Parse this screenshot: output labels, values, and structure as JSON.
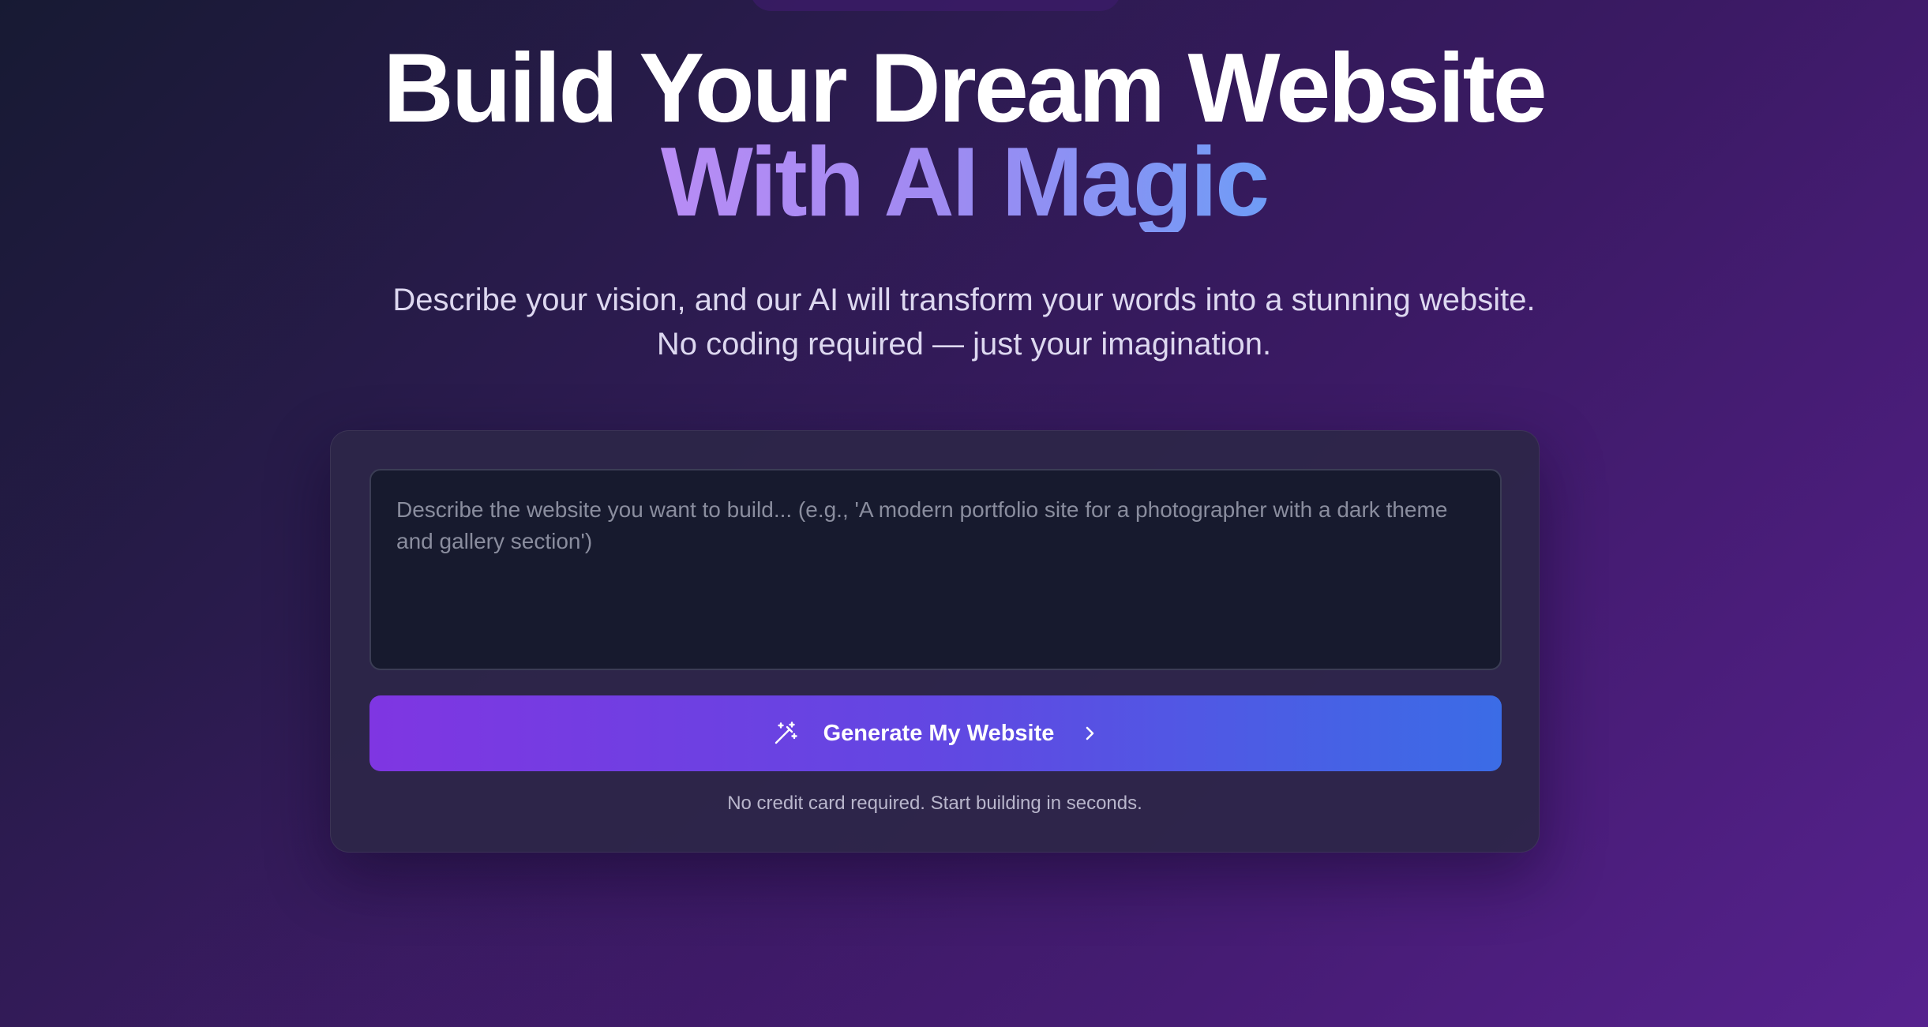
{
  "hero": {
    "title_line1": "Build Your Dream Website",
    "title_line2": "With AI Magic",
    "subtitle_line1": "Describe your vision, and our AI will transform your words into a stunning website.",
    "subtitle_line2": "No coding required — just your imagination."
  },
  "form": {
    "prompt_value": "",
    "prompt_placeholder": "Describe the website you want to build... (e.g., 'A modern portfolio site for a photographer with a dark theme and gallery section')",
    "button_label": "Generate My Website",
    "button_icon": "magic-wand-icon",
    "button_trailing_icon": "chevron-right-icon",
    "note": "No credit card required. Start building in seconds."
  },
  "colors": {
    "background_start": "#171a33",
    "background_end": "#56228e",
    "title_color": "#ffffff",
    "gradient_text_start": "#b88cf5",
    "gradient_text_end": "#6f9cf6",
    "button_gradient_start": "#7f36e2",
    "button_gradient_end": "#3b6ce6",
    "card_background": "#2c2648",
    "input_background": "#171a2e"
  }
}
